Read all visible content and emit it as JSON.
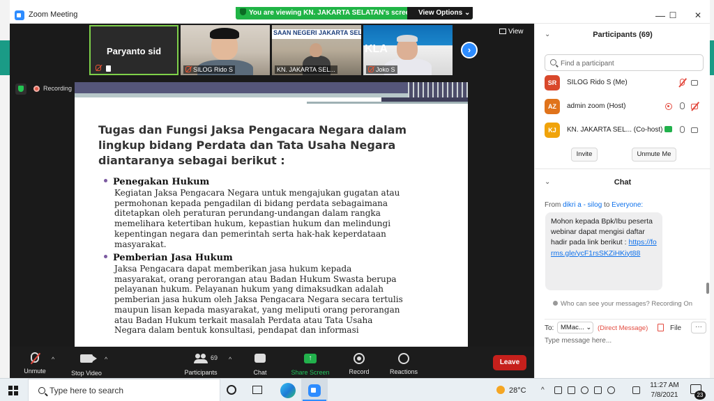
{
  "window": {
    "title": "Zoom Meeting",
    "minimize": "—",
    "maximize": "☐",
    "close": "✕"
  },
  "banner": {
    "text": "You are viewing KN.  JAKARTA SELATAN's screen",
    "view_options": "View Options ⌄"
  },
  "video_strip": {
    "tiles": [
      {
        "name": "Paryanto sid"
      },
      {
        "name": "SILOG Rido S"
      },
      {
        "name": "KN.  JAKARTA SEL...",
        "sign": "SAAN NEGERI JAKARTA SELATA"
      },
      {
        "name": "Joko S",
        "brand": "KLA"
      }
    ],
    "view_label": "View",
    "next_label": "›"
  },
  "recording": {
    "label": "Recording"
  },
  "slide": {
    "heading": "Tugas dan Fungsi Jaksa Pengacara Negara dalam lingkup bidang Perdata dan Tata Usaha Negara diantaranya sebagai berikut :",
    "bullets": [
      {
        "title": "Penegakan Hukum",
        "text": "Kegiatan Jaksa Pengacara Negara untuk mengajukan gugatan atau\npermohonan kepada pengadilan di bidang perdata sebagaimana\nditetapkan oleh peraturan perundang-undangan dalam rangka\nmemelihara ketertiban hukum, kepastian hukum dan melindungi\nkepentingan negara dan pemerintah serta hak-hak keperdataan\nmasyarakat."
      },
      {
        "title": "Pemberian Jasa Hukum",
        "text": "Jaksa Pengacara dapat memberikan jasa hukum kepada\nmasyarakat, orang perorangan atau Badan Hukum Swasta berupa\npelayanan hukum. Pelayanan hukum yang dimaksudkan adalah\npemberian jasa hukum oleh Jaksa Pengacara Negara secara tertulis\nmaupun lisan kepada masyarakat, yang meliputi orang perorangan\natau Badan Hukum terkait masalah Perdata atau Tata Usaha\nNegara dalam bentuk konsultasi, pendapat dan informasi"
      }
    ]
  },
  "toolbar": {
    "unmute": "Unmute",
    "stop_video": "Stop Video",
    "participants": "Participants",
    "participants_count": "69",
    "chat": "Chat",
    "share_screen": "Share Screen",
    "record": "Record",
    "reactions": "Reactions",
    "leave": "Leave",
    "caret": "^"
  },
  "participants_panel": {
    "title": "Participants (69)",
    "search_placeholder": "Find a participant",
    "list": [
      {
        "initials": "SR",
        "name": "SILOG Rido S (Me)",
        "color": "#d9482b"
      },
      {
        "initials": "AZ",
        "name": "admin zoom (Host)",
        "color": "#e0731b"
      },
      {
        "initials": "KJ",
        "name": "KN.  JAKARTA SEL... (Co-host)",
        "color": "#f0a30a"
      }
    ],
    "invite": "Invite",
    "unmute_me": "Unmute Me"
  },
  "chat_panel": {
    "title": "Chat",
    "from_label": "From",
    "from_name": "dikri a - silog",
    "to_word": "to",
    "to_name": "Everyone:",
    "message": "Mohon kepada Bpk/Ibu peserta webinar dapat mengisi daftar hadir pada link berikut :",
    "link": "https://forms.gle/ycF1rsSKZiHKiyt88",
    "who_can_see": "Who can see your messages? Recording On",
    "to_label": "To:",
    "to_value": "MMac... ⌄",
    "direct": "(Direct Message)",
    "file": "File",
    "more": "···",
    "input_placeholder": "Type message here..."
  },
  "taskbar": {
    "search_placeholder": "Type here to search",
    "weather": "28°C",
    "tray_up": "^",
    "time": "11:27 AM",
    "date": "7/8/2021",
    "notifications": "23"
  },
  "icons": [
    "zoom-logo-icon",
    "shield-icon",
    "record-dot-icon",
    "grid-view-icon",
    "chevron-right-icon",
    "mic-muted-icon",
    "video-icon",
    "participants-icon",
    "chat-icon",
    "share-screen-icon",
    "record-icon",
    "reactions-icon",
    "search-icon",
    "camera-icon",
    "file-icon",
    "windows-start-icon",
    "cortana-icon",
    "task-view-icon",
    "edge-icon",
    "zoom-taskbar-icon",
    "weather-sun-icon",
    "notification-icon"
  ]
}
